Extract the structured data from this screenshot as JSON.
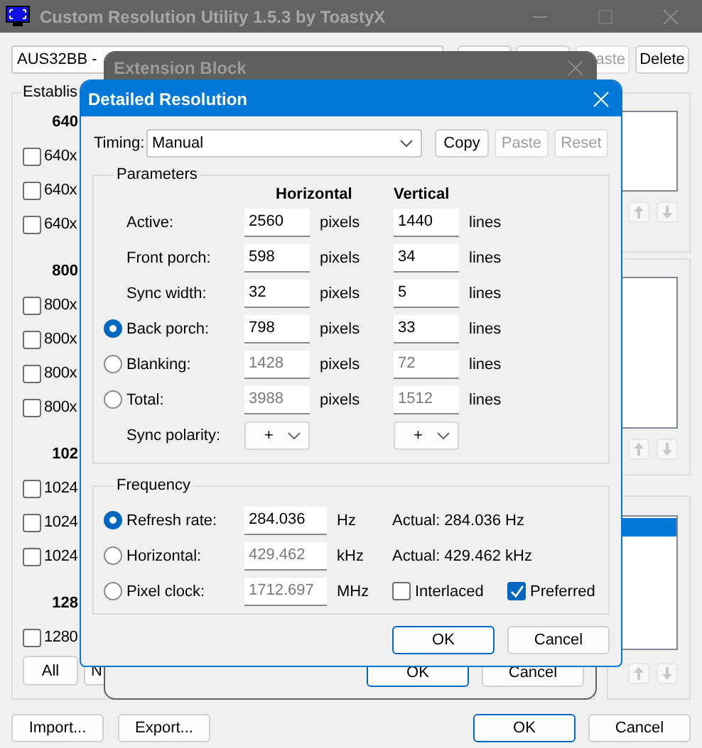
{
  "main_window": {
    "title": "Custom Resolution Utility 1.5.3 by ToastyX",
    "device": "AUS32BB -",
    "top_buttons": [
      {
        "label": "aste"
      },
      {
        "label": "Delete"
      }
    ],
    "left_group": {
      "title": "Establis",
      "items": [
        {
          "kind": "header",
          "label": "640"
        },
        {
          "kind": "checkbox",
          "label": "640x",
          "checked": false
        },
        {
          "kind": "checkbox",
          "label": "640x",
          "checked": false
        },
        {
          "kind": "checkbox",
          "label": "640x",
          "checked": false
        },
        {
          "kind": "header",
          "label": "800"
        },
        {
          "kind": "checkbox",
          "label": "800x",
          "checked": false
        },
        {
          "kind": "checkbox",
          "label": "800x",
          "checked": false
        },
        {
          "kind": "checkbox",
          "label": "800x",
          "checked": false
        },
        {
          "kind": "checkbox",
          "label": "800x",
          "checked": false
        },
        {
          "kind": "header",
          "label": "102"
        },
        {
          "kind": "checkbox",
          "label": "1024",
          "checked": false
        },
        {
          "kind": "checkbox",
          "label": "1024",
          "checked": false
        },
        {
          "kind": "checkbox",
          "label": "1024",
          "checked": false
        },
        {
          "kind": "header",
          "label": "128"
        },
        {
          "kind": "checkbox",
          "label": "1280",
          "checked": false
        }
      ],
      "buttons": [
        "All",
        "N"
      ]
    },
    "right_lists": [
      {
        "selected_row": false
      },
      {
        "selected_row": false
      },
      {
        "selected_row": true
      }
    ],
    "bottom_buttons": [
      {
        "label": "Import...",
        "default": false
      },
      {
        "label": "Export...",
        "default": false
      },
      {
        "label": "OK",
        "default": true
      },
      {
        "label": "Cancel",
        "default": false
      }
    ]
  },
  "extension_window": {
    "title": "Extension Block",
    "buttons": [
      {
        "label": "OK",
        "default": true
      },
      {
        "label": "Cancel",
        "default": false
      }
    ]
  },
  "detail_dialog": {
    "title": "Detailed Resolution",
    "timing": {
      "label": "Timing:",
      "value": "Manual"
    },
    "buttons": [
      {
        "label": "Copy",
        "disabled": false
      },
      {
        "label": "Paste",
        "disabled": true
      },
      {
        "label": "Reset",
        "disabled": true
      }
    ],
    "parameters": {
      "title": "Parameters",
      "columns": [
        "Horizontal",
        "Vertical"
      ],
      "rows": [
        {
          "kind": "plain",
          "label": "Active:",
          "horizontal": "2560",
          "h_unit": "pixels",
          "vertical": "1440",
          "v_unit": "lines",
          "disabled": false
        },
        {
          "kind": "plain",
          "label": "Front porch:",
          "horizontal": "598",
          "h_unit": "pixels",
          "vertical": "34",
          "v_unit": "lines",
          "disabled": false
        },
        {
          "kind": "plain",
          "label": "Sync width:",
          "horizontal": "32",
          "h_unit": "pixels",
          "vertical": "5",
          "v_unit": "lines",
          "disabled": false
        },
        {
          "kind": "radio",
          "label": "Back porch:",
          "selected": true,
          "horizontal": "798",
          "h_unit": "pixels",
          "vertical": "33",
          "v_unit": "lines",
          "disabled": false
        },
        {
          "kind": "radio",
          "label": "Blanking:",
          "selected": false,
          "horizontal": "1428",
          "h_unit": "pixels",
          "vertical": "72",
          "v_unit": "lines",
          "disabled": true
        },
        {
          "kind": "radio",
          "label": "Total:",
          "selected": false,
          "horizontal": "3988",
          "h_unit": "pixels",
          "vertical": "1512",
          "v_unit": "lines",
          "disabled": true
        }
      ],
      "sync_polarity": {
        "label": "Sync polarity:",
        "horizontal": "+",
        "vertical": "+"
      }
    },
    "frequency": {
      "title": "Frequency",
      "rows": [
        {
          "label": "Refresh rate:",
          "selected": true,
          "value": "284.036",
          "unit": "Hz",
          "disabled": false,
          "actual": "Actual: 284.036 Hz"
        },
        {
          "label": "Horizontal:",
          "selected": false,
          "value": "429.462",
          "unit": "kHz",
          "disabled": true,
          "actual": "Actual: 429.462 kHz"
        },
        {
          "label": "Pixel clock:",
          "selected": false,
          "value": "1712.697",
          "unit": "MHz",
          "disabled": true
        }
      ],
      "options": [
        {
          "label": "Interlaced",
          "checked": false
        },
        {
          "label": "Preferred",
          "checked": true
        }
      ]
    },
    "footer_buttons": [
      {
        "label": "OK",
        "default": true
      },
      {
        "label": "Cancel",
        "default": false
      }
    ]
  }
}
